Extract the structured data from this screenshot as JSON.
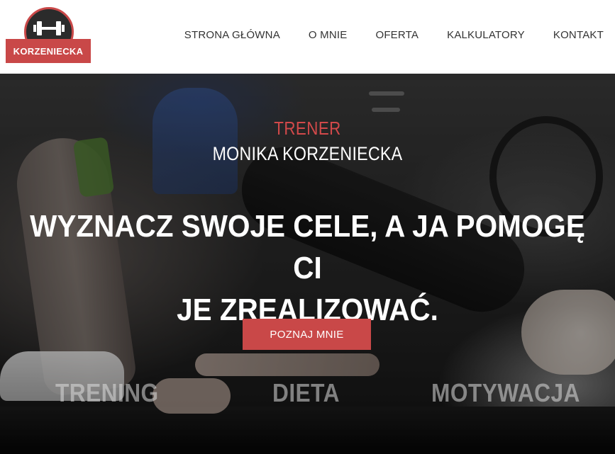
{
  "brand": {
    "logo_text": "KORZENIECKA",
    "accent_color": "#c94848",
    "icon": "dumbbell-icon"
  },
  "nav": {
    "items": [
      {
        "label": "STRONA GŁÓWNA"
      },
      {
        "label": "O MNIE"
      },
      {
        "label": "OFERTA"
      },
      {
        "label": "KALKULATORY"
      },
      {
        "label": "KONTAKT"
      }
    ]
  },
  "hero": {
    "eyebrow": "TRENER",
    "name": "MONIKA KORZENIECKA",
    "headline_line1": "WYZNACZ SWOJE CELE, A JA POMOGĘ CI",
    "headline_line2": "JE ZREALIZOWAĆ.",
    "cta_label": "POZNAJ MNIE",
    "features": [
      "TRENING",
      "DIETA",
      "MOTYWACJA"
    ]
  }
}
